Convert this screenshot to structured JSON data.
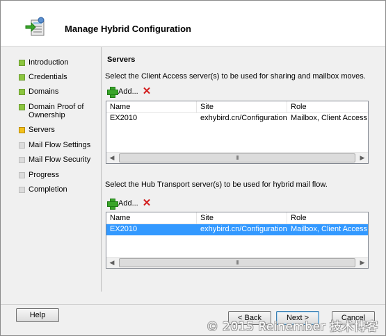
{
  "window": {
    "title": "Manage Hybrid Configuration"
  },
  "nav": {
    "items": [
      {
        "label": "Introduction",
        "state": "complete"
      },
      {
        "label": "Credentials",
        "state": "complete"
      },
      {
        "label": "Domains",
        "state": "complete"
      },
      {
        "label": "Domain Proof of Ownership",
        "state": "complete"
      },
      {
        "label": "Servers",
        "state": "current"
      },
      {
        "label": "Mail Flow Settings",
        "state": "pending"
      },
      {
        "label": "Mail Flow Security",
        "state": "pending"
      },
      {
        "label": "Progress",
        "state": "pending"
      },
      {
        "label": "Completion",
        "state": "pending"
      }
    ]
  },
  "main": {
    "section_title": "Servers",
    "client_access": {
      "instruction": "Select the Client Access server(s) to be used for sharing and mailbox moves.",
      "add_label": "Add...",
      "columns": [
        "Name",
        "Site",
        "Role"
      ],
      "rows": [
        {
          "name": "EX2010",
          "site": "exhybird.cn/Configuration/...",
          "role": "Mailbox, Client Access, Hu",
          "selected": false
        }
      ]
    },
    "hub_transport": {
      "instruction": "Select the Hub Transport server(s) to be used for hybrid mail flow.",
      "add_label": "Add...",
      "columns": [
        "Name",
        "Site",
        "Role"
      ],
      "rows": [
        {
          "name": "EX2010",
          "site": "exhybird.cn/Configuration/...",
          "role": "Mailbox, Client Access, Hu",
          "selected": true
        }
      ]
    }
  },
  "footer": {
    "help_label": "Help",
    "back_label": "< Back",
    "next_label": "Next >",
    "cancel_label": "Cancel",
    "watermark": "© 2015 Reinember 技术博客"
  },
  "colors": {
    "complete": "#8cc63f",
    "current": "#f3c11b",
    "pending": "#dcdcdc",
    "selection": "#3399ff",
    "delete": "#d21c1c"
  },
  "icons": {
    "header": "hybrid-config-icon",
    "add": "green-plus-icon",
    "delete": "red-x-icon"
  }
}
